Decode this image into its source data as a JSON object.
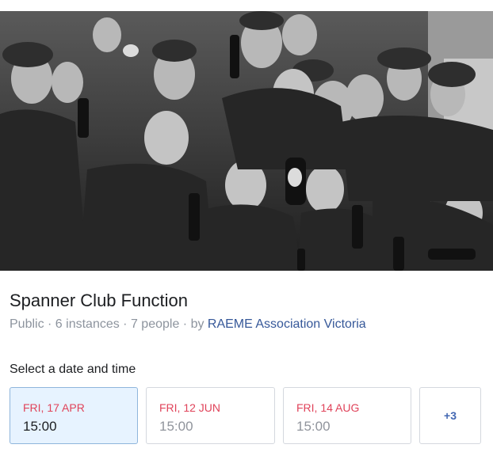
{
  "event": {
    "cover_alt": "Black and white photo of celebrating soldiers holding bottles",
    "title": "Spanner Club Function",
    "privacy": "Public",
    "instances": "6 instances",
    "people": "7 people",
    "separator": " · ",
    "by_label": "by ",
    "host": "RAEME Association Victoria"
  },
  "schedule": {
    "label": "Select a date and time",
    "dates": [
      {
        "day": "FRI, 17 APR",
        "time": "15:00",
        "selected": true
      },
      {
        "day": "FRI, 12 JUN",
        "time": "15:00",
        "selected": false
      },
      {
        "day": "FRI, 14 AUG",
        "time": "15:00",
        "selected": false
      }
    ],
    "more": "+3"
  },
  "colors": {
    "date_red": "#e0435a",
    "link_blue": "#365899",
    "more_blue": "#4267b2",
    "selected_bg": "#e7f3ff"
  }
}
